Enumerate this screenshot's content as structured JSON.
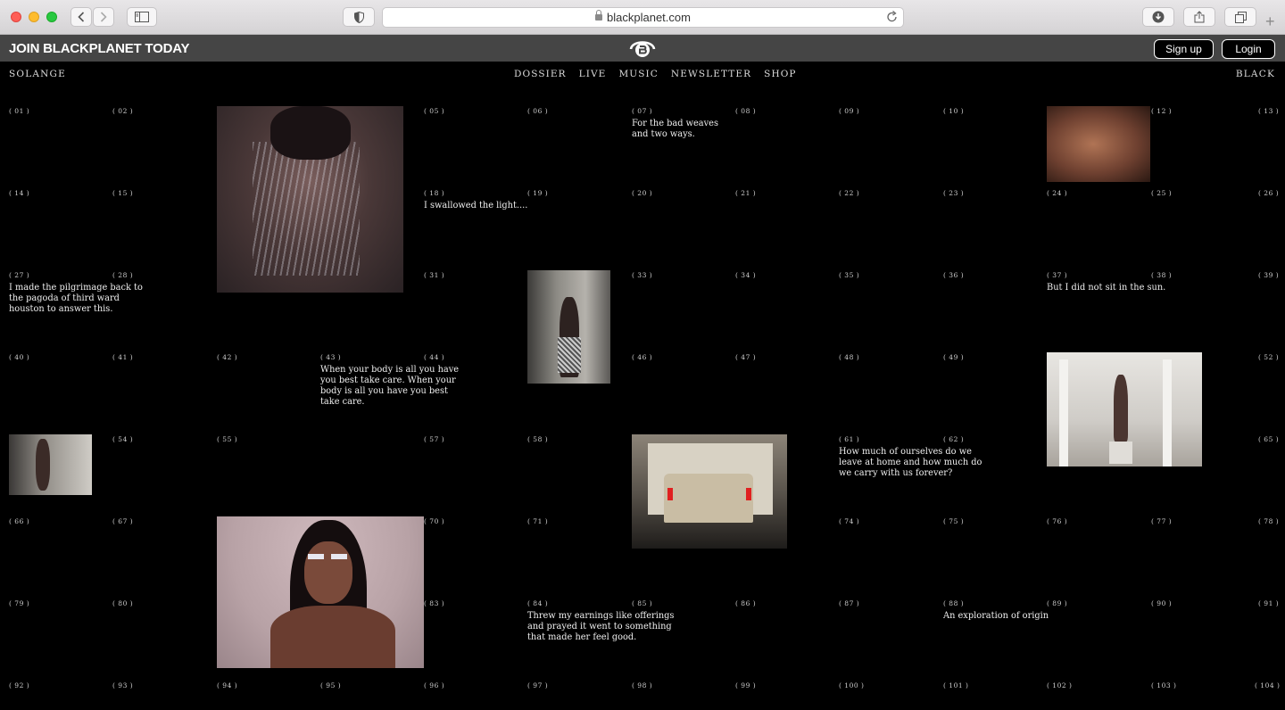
{
  "browser": {
    "url": "blackplanet.com",
    "new_tab_glyph": "+"
  },
  "banner": {
    "title": "JOIN BLACKPLANET TODAY",
    "signup_label": "Sign up",
    "login_label": "Login"
  },
  "nav": {
    "left_brand": "SOLANGE",
    "right_brand": "BLACK",
    "items": [
      "DOSSIER",
      "LIVE",
      "MUSIC",
      "NEWSLETTER",
      "SHOP"
    ]
  },
  "grid_numbers": [
    "( 01 )",
    "( 02 )",
    "( 05 )",
    "( 06 )",
    "( 07 )",
    "( 08 )",
    "( 09 )",
    "( 10 )",
    "( 12 )",
    "( 13 )",
    "( 14 )",
    "( 15 )",
    "( 18 )",
    "( 19 )",
    "( 20 )",
    "( 21 )",
    "( 22 )",
    "( 23 )",
    "( 24 )",
    "( 25 )",
    "( 26 )",
    "( 27 )",
    "( 28 )",
    "( 31 )",
    "( 33 )",
    "( 34 )",
    "( 35 )",
    "( 36 )",
    "( 37 )",
    "( 38 )",
    "( 39 )",
    "( 40 )",
    "( 41 )",
    "( 42 )",
    "( 43 )",
    "( 44 )",
    "( 46 )",
    "( 47 )",
    "( 48 )",
    "( 49 )",
    "( 52 )",
    "( 54 )",
    "( 55 )",
    "( 57 )",
    "( 58 )",
    "( 61 )",
    "( 62 )",
    "( 65 )",
    "( 66 )",
    "( 67 )",
    "( 70 )",
    "( 71 )",
    "( 74 )",
    "( 75 )",
    "( 76 )",
    "( 77 )",
    "( 78 )",
    "( 79 )",
    "( 80 )",
    "( 83 )",
    "( 84 )",
    "( 85 )",
    "( 86 )",
    "( 87 )",
    "( 88 )",
    "( 89 )",
    "( 90 )",
    "( 91 )",
    "( 92 )",
    "( 93 )",
    "( 94 )",
    "( 95 )",
    "( 96 )",
    "( 97 )",
    "( 98 )",
    "( 99 )",
    "( 100 )",
    "( 101 )",
    "( 102 )",
    "( 103 )",
    "( 104 )"
  ],
  "captions": {
    "c07": "For the bad weaves and two ways.",
    "c18": "I swallowed the light....",
    "c27": "I made the pilgrimage back to the pagoda of third ward houston to answer this.",
    "c37": "But I did not sit in the sun.",
    "c43": "When your body is all you have you best take care. When your body is all you have you best take care.",
    "c61": "How much of ourselves do we leave at home and how much do we carry with us forever?",
    "c84": "Threw my earnings like offerings and prayed it went to something that made her feel good.",
    "c88": "An exploration of origin"
  }
}
